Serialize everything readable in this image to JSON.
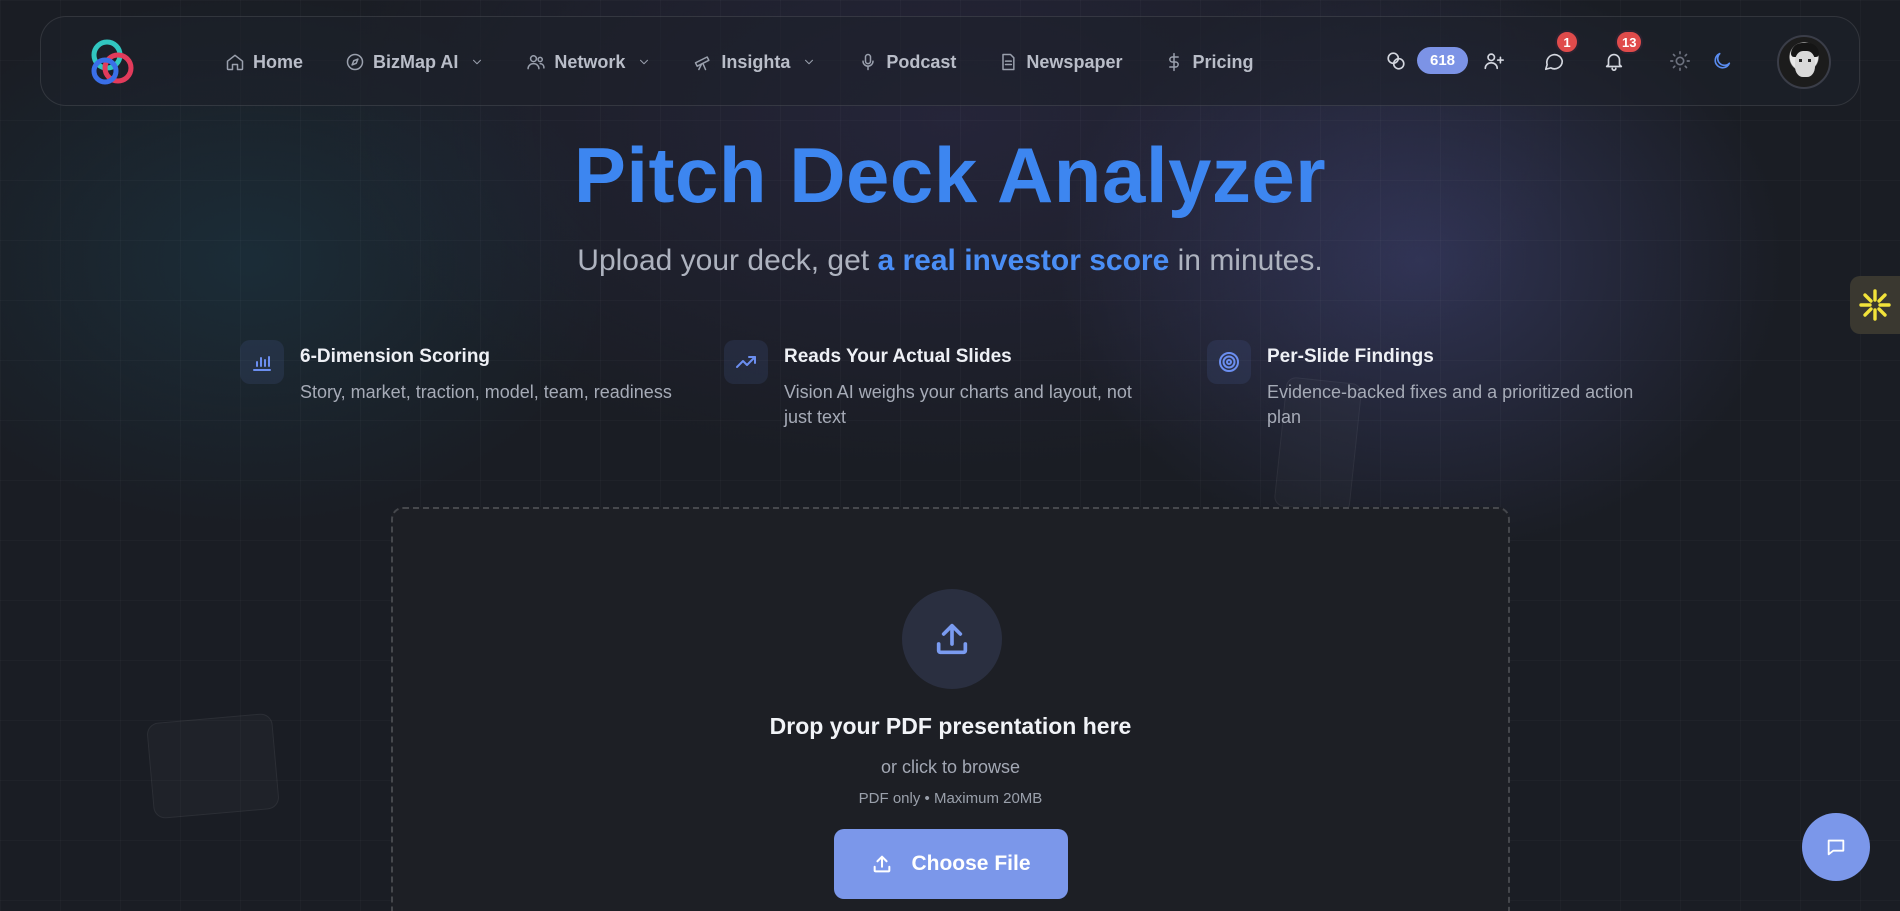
{
  "nav": {
    "items": [
      {
        "label": "Home",
        "icon": "home-icon",
        "dropdown": false
      },
      {
        "label": "BizMap AI",
        "icon": "compass-icon",
        "dropdown": true
      },
      {
        "label": "Network",
        "icon": "users-icon",
        "dropdown": true
      },
      {
        "label": "Insighta",
        "icon": "telescope-icon",
        "dropdown": true
      },
      {
        "label": "Podcast",
        "icon": "microphone-icon",
        "dropdown": false
      },
      {
        "label": "Newspaper",
        "icon": "document-icon",
        "dropdown": false
      },
      {
        "label": "Pricing",
        "icon": "dollar-icon",
        "dropdown": false
      }
    ],
    "credits": "618",
    "messages_badge": "1",
    "notifications_badge": "13"
  },
  "hero": {
    "title": "Pitch Deck Analyzer",
    "subtitle_before": "Upload your deck, get ",
    "subtitle_highlight": "a real investor score",
    "subtitle_after": " in minutes."
  },
  "features": [
    {
      "title": "6-Dimension Scoring",
      "desc": "Story, market, traction, model, team, readiness",
      "icon": "bar-chart-icon"
    },
    {
      "title": "Reads Your Actual Slides",
      "desc": "Vision AI weighs your charts and layout, not just text",
      "icon": "trending-up-icon"
    },
    {
      "title": "Per-Slide Findings",
      "desc": "Evidence-backed fixes and a prioritized action plan",
      "icon": "target-icon"
    }
  ],
  "upload": {
    "title": "Drop your PDF presentation here",
    "subtitle": "or click to browse",
    "note": "PDF only • Maximum 20MB",
    "button_label": "Choose File"
  },
  "colors": {
    "accent": "#3d86f0",
    "button": "#7b97ea",
    "badge": "#e04b4b",
    "background": "#1a1d24"
  }
}
